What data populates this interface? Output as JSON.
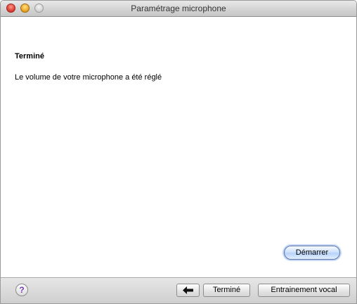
{
  "window": {
    "title": "Paramétrage microphone"
  },
  "main": {
    "heading": "Terminé",
    "message": "Le volume de votre microphone a été réglé",
    "start_button_label": "Démarrer"
  },
  "footer": {
    "help_glyph": "?",
    "back_icon": "left-arrow-icon",
    "done_label": "Terminé",
    "training_label": "Entrainement vocal"
  },
  "colors": {
    "close": "#e2473d",
    "minimize": "#f1ad2c",
    "zoom": "#d6d6d6",
    "accent": "#b6d3f8",
    "help_glyph": "#7a3bb8"
  }
}
